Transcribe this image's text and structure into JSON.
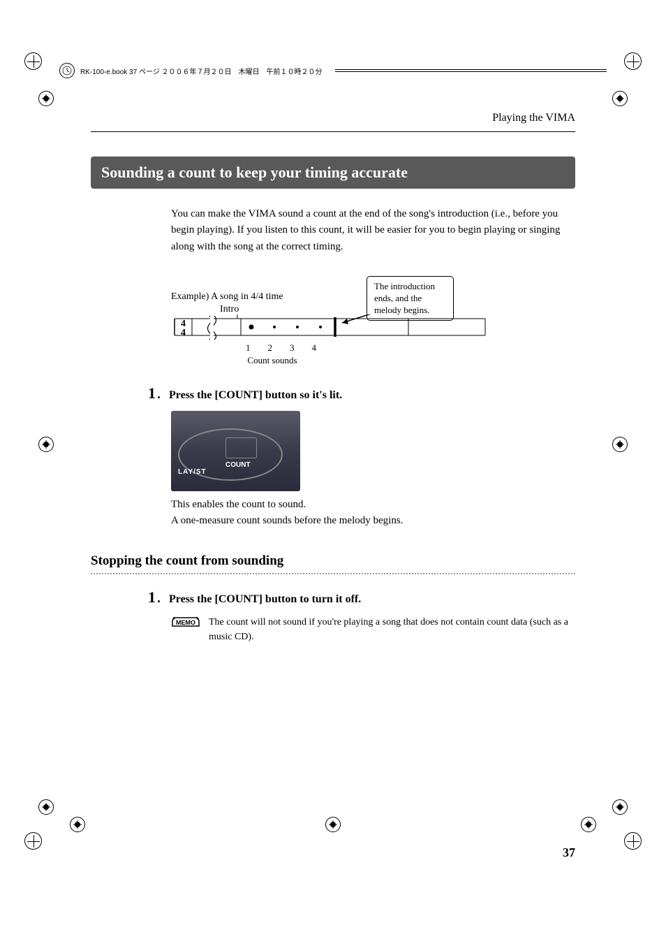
{
  "header": {
    "filename": "RK-100-e.book  37 ページ  ２００６年７月２０日　木曜日　午前１０時２０分"
  },
  "running_head": "Playing the VIMA",
  "section_title": "Sounding a count to keep your timing accurate",
  "intro_text": "You can make the VIMA sound a count at the end of the song's introduction (i.e., before you begin playing). If you listen to this count, it will be easier for you to begin playing or singing along with the song at the correct timing.",
  "diagram": {
    "example_label": "Example) A song in 4/4 time",
    "intro_label": "Intro",
    "box_text": "The introduction ends, and the melody begins.",
    "count_nums": "1234",
    "count_label": "Count sounds",
    "time_sig_top": "4",
    "time_sig_bot": "4"
  },
  "step1": {
    "num": "1",
    "text": "Press the [COUNT] button so it's lit.",
    "img_play_label": "LAY/ST",
    "img_count_label": "COUNT",
    "body1": "This enables the count to sound.",
    "body2": "A one-measure count sounds before the melody begins."
  },
  "subsection": {
    "title": "Stopping the count from sounding"
  },
  "step2": {
    "num": "1",
    "text": "Press the [COUNT] button to turn it off.",
    "memo_label": "MEMO",
    "memo_text": "The count will not sound if you're playing a song that does not contain count data (such as a music CD)."
  },
  "page_num": "37"
}
